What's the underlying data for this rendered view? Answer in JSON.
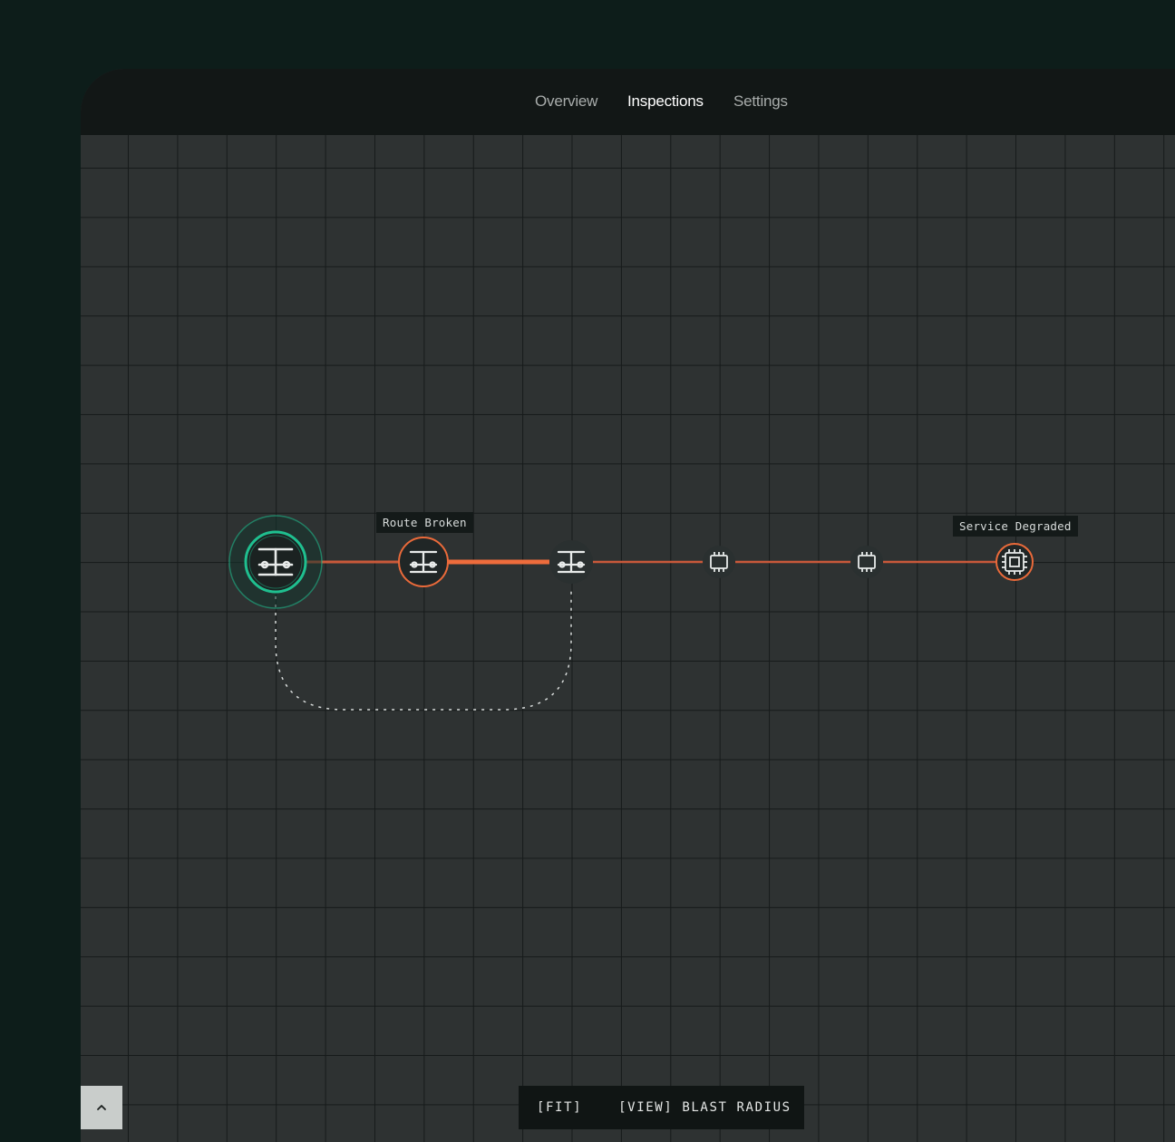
{
  "nav": {
    "tabs": [
      {
        "label": "Overview",
        "active": false
      },
      {
        "label": "Inspections",
        "active": true
      },
      {
        "label": "Settings",
        "active": false
      }
    ]
  },
  "graph": {
    "labels": {
      "route_broken": "Route Broken",
      "service_degraded": "Service Degraded"
    },
    "nodes": [
      {
        "id": "router-1",
        "icon": "router-icon",
        "status": "selected"
      },
      {
        "id": "router-2",
        "icon": "router-icon",
        "status": "error"
      },
      {
        "id": "router-3",
        "icon": "router-icon",
        "status": "normal"
      },
      {
        "id": "chip-1",
        "icon": "chip-icon",
        "status": "normal"
      },
      {
        "id": "chip-2",
        "icon": "chip-icon",
        "status": "normal"
      },
      {
        "id": "chip-3",
        "icon": "chip-icon",
        "status": "error"
      }
    ],
    "colors": {
      "selected": "#1fbf8f",
      "error": "#ea6a3a",
      "edge": "#c9593a",
      "edge_active": "#ee6c3c",
      "dashed": "#d8dcdb"
    }
  },
  "toolbar": {
    "fit_label": "[FIT]",
    "blast_radius_label": "[VIEW] BLAST RADIUS"
  },
  "icons": {
    "collapse": "chevron-up-icon"
  }
}
